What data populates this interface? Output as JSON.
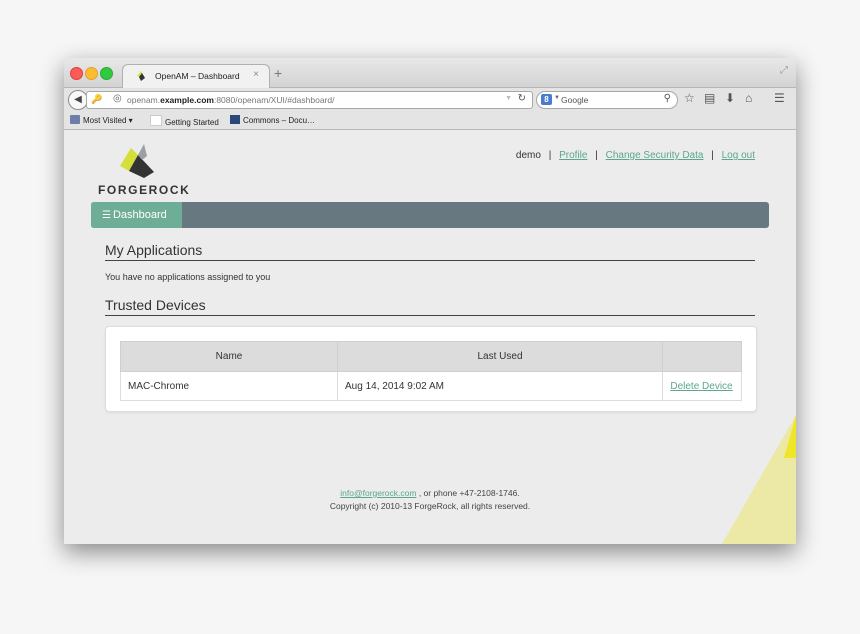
{
  "browser": {
    "tab_title": "OpenAM – Dashboard",
    "tab_close": "×",
    "new_tab": "+",
    "url_host_pre": "openam.",
    "url_host_bold": "example.com",
    "url_rest": ":8080/openam/XUI/#dashboard/",
    "search_placeholder": "Google",
    "bookmarks": [
      "Most Visited ▾",
      "Getting Started",
      "Commons – Docu…"
    ]
  },
  "header": {
    "logo_text": "FORGEROCK",
    "username": "demo",
    "links": [
      "Profile",
      "Change Security Data",
      "Log out"
    ],
    "separator": "|"
  },
  "nav": {
    "dashboard_label": "Dashboard"
  },
  "applications": {
    "title": "My Applications",
    "empty_message": "You have no applications assigned to you"
  },
  "devices": {
    "title": "Trusted Devices",
    "columns": [
      "Name",
      "Last Used",
      ""
    ],
    "rows": [
      {
        "name": "MAC-Chrome",
        "last_used": "Aug 14, 2014 9:02 AM",
        "action": "Delete Device"
      }
    ]
  },
  "footer": {
    "email": "info@forgerock.com",
    "phone_text": " , or phone +47-2108-1746.",
    "copyright": "Copyright (c) 2010-13 ForgeRock, all rights reserved."
  },
  "colors": {
    "accent": "#6fae96",
    "nav_bar": "#687880",
    "link": "#5aa78e",
    "deco_yellow": "#f0e628"
  }
}
